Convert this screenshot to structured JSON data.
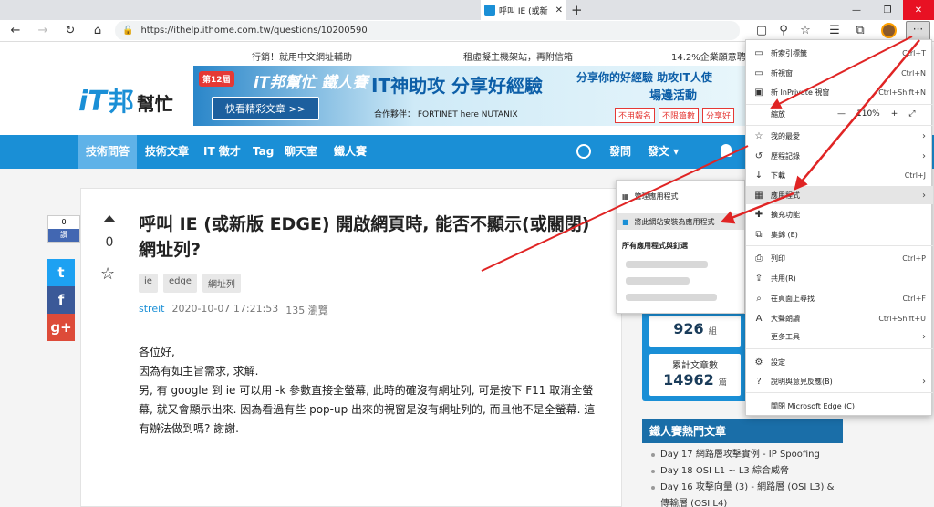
{
  "browser": {
    "tab_title": "呼叫 IE (或新",
    "tab_close": "✕",
    "new_tab": "+",
    "url": "https://ithelp.ithome.com.tw/questions/10200590",
    "menu_dots": "···",
    "win_min": "—",
    "win_max": "❐",
    "win_close": "✕"
  },
  "site": {
    "topbar": [
      "行銷！就用中文網址輔助",
      "租虛擬主機架站，再附信箱",
      "14.2%企業願意聘"
    ],
    "logo": {
      "it": "iT",
      "bang": "邦",
      "bm": "幫忙"
    },
    "banner": {
      "badge": "第12屆",
      "iron": "iT邦幫忙 鐵人賽",
      "button": "快看精彩文章 >>",
      "headline": "IT神助攻 分享好經驗",
      "partner": "合作夥伴： FORTINET   here   NUTANIX",
      "right1": "分享你的好經驗 助攻IT人使",
      "right2": "場邊活動",
      "tags": [
        "不用報名",
        "不限篇數",
        "分享好"
      ]
    },
    "nav": [
      "技術問答",
      "技術文章",
      "IT 徵才",
      "Tag",
      "聊天室",
      "鐵人賽"
    ],
    "nav_right": [
      "發問",
      "發文 ▾"
    ]
  },
  "question": {
    "like_count": "0",
    "like_label": "讚",
    "share": [
      "t",
      "f",
      "g+"
    ],
    "votes": "0",
    "title": "呼叫 IE (或新版 EDGE) 開啟網頁時, 能否不顯示(或關閉)網址列?",
    "tags": [
      "ie",
      "edge",
      "網址列"
    ],
    "author": "streit",
    "date": "2020-10-07 17:21:53",
    "views": "135 瀏覽",
    "body": [
      "各位好,",
      "因為有如主旨需求, 求解.",
      "另, 有 google 到 ie 可以用 -k 參數直接全螢幕, 此時的確沒有網址列, 可是按下 F11 取消全螢幕, 就又會顯示出來. 因為看過有些 pop-up 出來的視窗是沒有網址列的, 而且他不是全螢幕. 這有辦法做到嗎? 謝謝."
    ]
  },
  "sidebar": {
    "stat1": {
      "num": "926",
      "unit": "組"
    },
    "stat2": {
      "label": "累計文章數",
      "num": "14962",
      "unit": "篇"
    },
    "hot_title": "鐵人賽熱門文章",
    "hot": [
      "Day 17 網路層攻擊實例 - IP Spoofing",
      "Day 18 OSI L1 ~ L3 綜合威脅",
      "Day 16 攻擊向量 (3) - 網路層 (OSI L3) & 傳輸層 (OSI L4)"
    ]
  },
  "apps_submenu": {
    "manage": "管理應用程式",
    "install": "將此網站安裝為應用程式",
    "all": "所有應用程式與釘選"
  },
  "edge_menu": {
    "new_tab": {
      "label": "新索引標籤",
      "shortcut": "Ctrl+T"
    },
    "new_window": {
      "label": "新視窗",
      "shortcut": "Ctrl+N"
    },
    "inprivate": {
      "label": "新 InPrivate 視窗",
      "shortcut": "Ctrl+Shift+N"
    },
    "zoom": {
      "label": "縮放",
      "value": "110%",
      "minus": "—",
      "plus": "+",
      "full": "⤢"
    },
    "favorites": {
      "label": "我的最愛"
    },
    "history": {
      "label": "歷程記錄"
    },
    "downloads": {
      "label": "下載",
      "shortcut": "Ctrl+J"
    },
    "apps": {
      "label": "應用程式"
    },
    "extensions": {
      "label": "擴充功能"
    },
    "collections": {
      "label": "集錦 (E)"
    },
    "print": {
      "label": "列印",
      "shortcut": "Ctrl+P"
    },
    "share": {
      "label": "共用(R)"
    },
    "find": {
      "label": "在頁面上尋找",
      "shortcut": "Ctrl+F"
    },
    "read_aloud": {
      "label": "大聲朗讀",
      "shortcut": "Ctrl+Shift+U"
    },
    "more_tools": {
      "label": "更多工具"
    },
    "settings": {
      "label": "設定"
    },
    "help": {
      "label": "說明與意見反應(B)"
    },
    "close": {
      "label": "關閉 Microsoft Edge (C)"
    }
  },
  "colors": {
    "accent": "#1a8fd6",
    "arrow": "#e02424"
  }
}
